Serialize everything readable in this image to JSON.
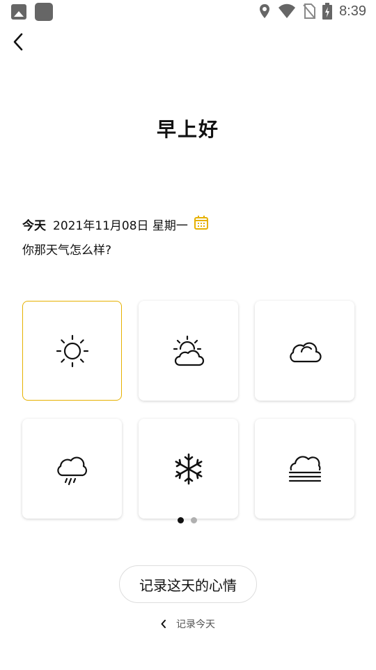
{
  "status_bar": {
    "time": "8:39",
    "icons": [
      "image-icon",
      "app-square-icon",
      "location-icon",
      "wifi-icon",
      "no-sim-icon",
      "battery-charging-icon"
    ]
  },
  "header": {
    "back_icon": "chevron-left-icon"
  },
  "greeting": "早上好",
  "date": {
    "today_label": "今天",
    "date_text": "2021年11月08日 星期一",
    "calendar_icon": "calendar-icon",
    "accent_color": "#e6b100"
  },
  "question": "你那天气怎么样?",
  "weather_options": [
    {
      "name": "sunny",
      "icon": "sun-icon",
      "selected": true
    },
    {
      "name": "partly-cloudy",
      "icon": "partly-cloudy-icon",
      "selected": false
    },
    {
      "name": "cloudy",
      "icon": "cloud-icon",
      "selected": false
    },
    {
      "name": "rain",
      "icon": "rain-icon",
      "selected": false
    },
    {
      "name": "snow",
      "icon": "snowflake-icon",
      "selected": false
    },
    {
      "name": "fog",
      "icon": "fog-icon",
      "selected": false
    }
  ],
  "pager": {
    "pages": 2,
    "current": 1
  },
  "record_button_label": "记录这天的心情",
  "record_today": {
    "icon": "chevron-left-icon",
    "label": "记录今天"
  }
}
